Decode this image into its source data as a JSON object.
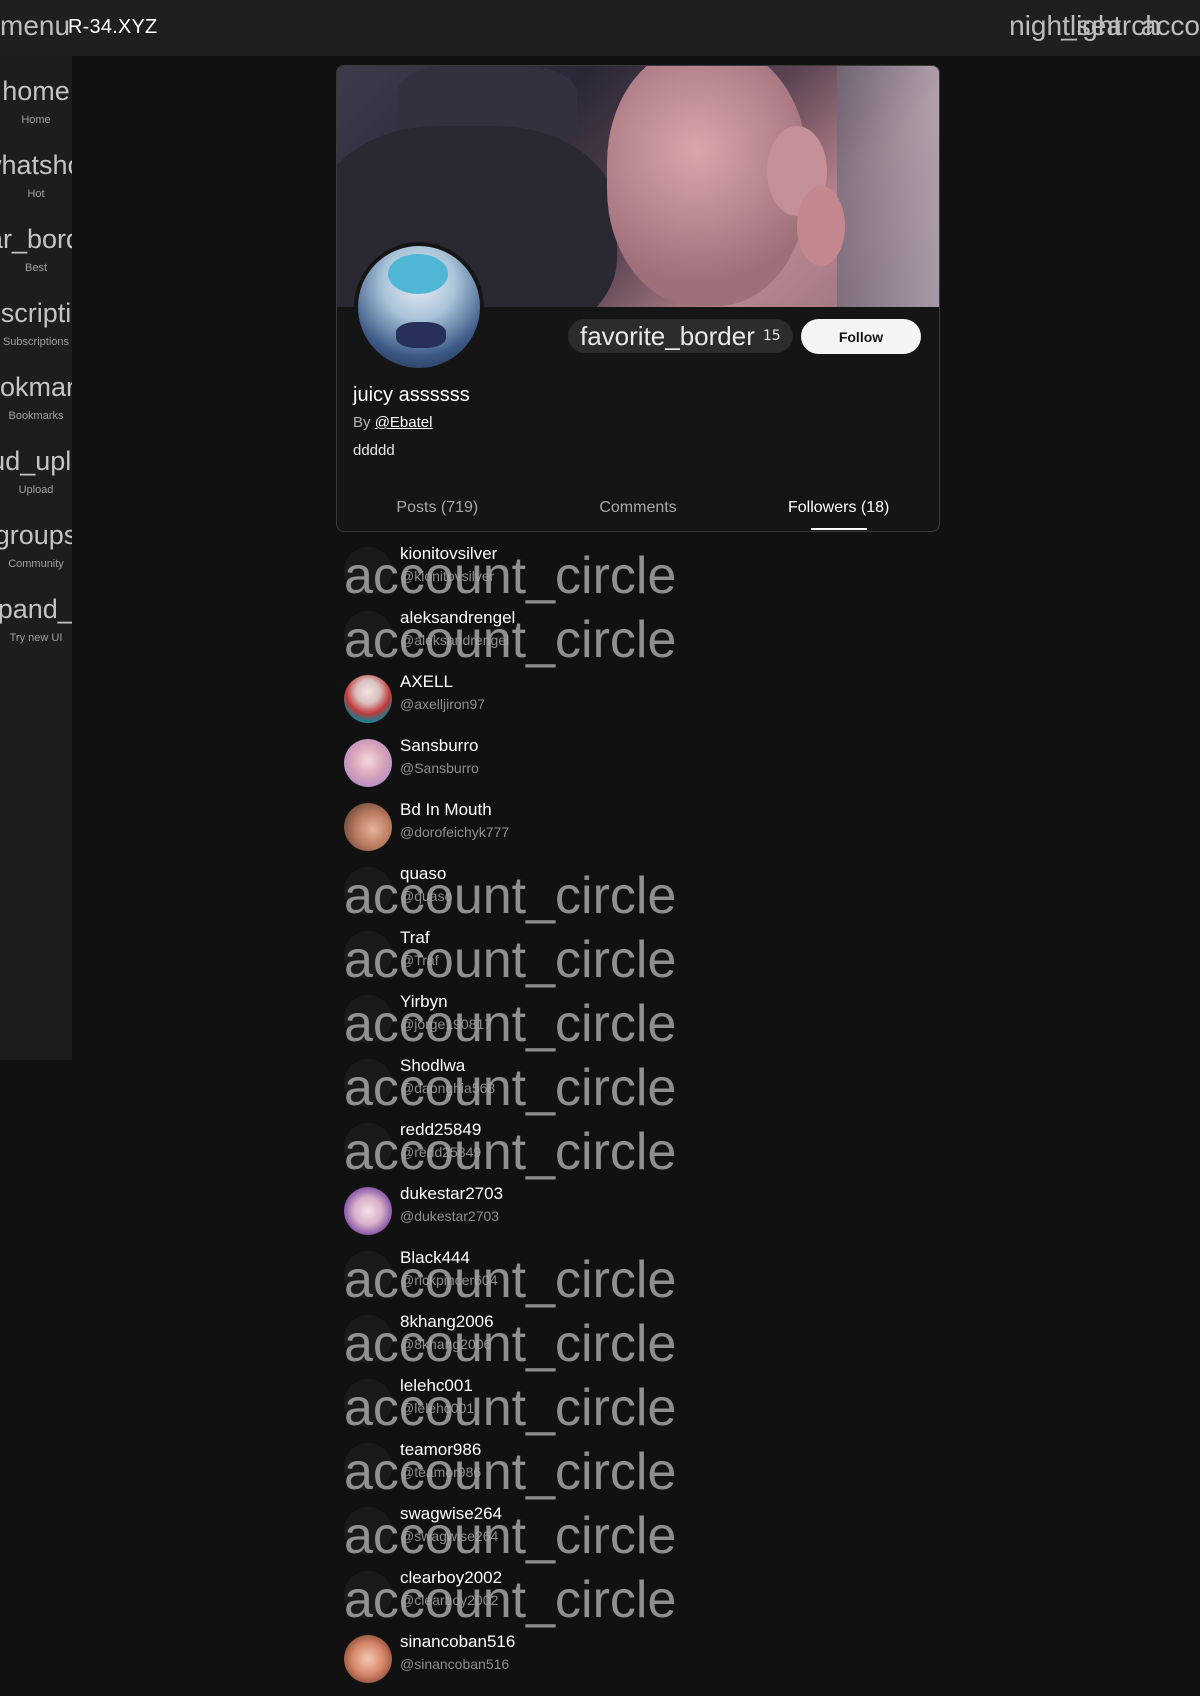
{
  "topbar": {
    "menu_icon_text": "menu",
    "logo": "R-34.XYZ",
    "nightlight_icon_text": "nightlight",
    "search_icon_text": "_search",
    "account_icon_text": "acco"
  },
  "sidebar": {
    "items": [
      {
        "icon": "home",
        "label": "Home"
      },
      {
        "icon": "whatshot",
        "label": "Hot"
      },
      {
        "icon": "star_border",
        "label": "Best"
      },
      {
        "icon": "subscriptions",
        "label": "Subscriptions"
      },
      {
        "icon": "bookmarks",
        "label": "Bookmarks"
      },
      {
        "icon": "cloud_upload",
        "label": "Upload"
      },
      {
        "icon": "groups",
        "label": "Community"
      },
      {
        "icon": "expand_up",
        "label": "Try new UI"
      }
    ]
  },
  "profile": {
    "favorite_icon_text": "favorite_border",
    "favorite_count": "15",
    "follow_label": "Follow",
    "title": "juicy assssss",
    "by_prefix": "By ",
    "author": "@Ebatel",
    "description": "ddddd",
    "tabs": [
      {
        "label": "Posts (719)",
        "active": false
      },
      {
        "label": "Comments",
        "active": false
      },
      {
        "label": "Followers (18)",
        "active": true
      }
    ]
  },
  "placeholder_icon_text": "account_circle",
  "followers": [
    {
      "name": "kionitovsilver",
      "handle": "@kionitovsilver",
      "placeholder": true
    },
    {
      "name": "aleksandrengel",
      "handle": "@aleksandrengel",
      "placeholder": true
    },
    {
      "name": "AXELL",
      "handle": "@axelljiron97",
      "placeholder": false
    },
    {
      "name": "Sansburro",
      "handle": "@Sansburro",
      "placeholder": false
    },
    {
      "name": "Bd In Mouth",
      "handle": "@dorofeichyk777",
      "placeholder": false
    },
    {
      "name": "quaso",
      "handle": "@quaso",
      "placeholder": true
    },
    {
      "name": "Traf",
      "handle": "@Traf",
      "placeholder": true
    },
    {
      "name": "Yirbyn",
      "handle": "@jorge190817",
      "placeholder": true
    },
    {
      "name": "Shodlwa",
      "handle": "@daonghia568",
      "placeholder": true
    },
    {
      "name": "redd25849",
      "handle": "@redd25849",
      "placeholder": true
    },
    {
      "name": "dukestar2703",
      "handle": "@dukestar2703",
      "placeholder": false
    },
    {
      "name": "Black444",
      "handle": "@rickpincer604",
      "placeholder": true
    },
    {
      "name": "8khang2006",
      "handle": "@8khang2006",
      "placeholder": true
    },
    {
      "name": "lelehc001",
      "handle": "@lelehc001",
      "placeholder": true
    },
    {
      "name": "teamor986",
      "handle": "@teamor986",
      "placeholder": true
    },
    {
      "name": "swagwise264",
      "handle": "@swagwise264",
      "placeholder": true
    },
    {
      "name": "clearboy2002",
      "handle": "@clearboy2002",
      "placeholder": true
    },
    {
      "name": "sinancoban516",
      "handle": "@sinancoban516",
      "placeholder": false
    }
  ]
}
